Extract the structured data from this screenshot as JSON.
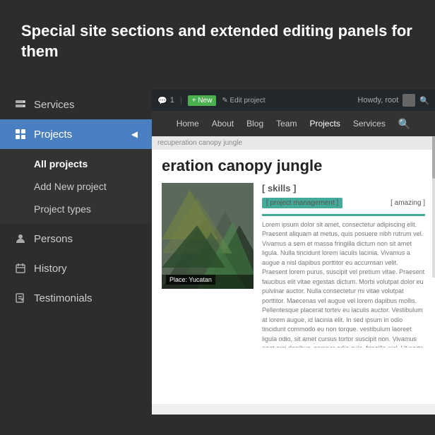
{
  "header": {
    "title": "Special site sections and extended editing panels for them"
  },
  "sidebar": {
    "items": [
      {
        "id": "services",
        "label": "Services",
        "icon": "server-icon",
        "active": false
      },
      {
        "id": "projects",
        "label": "Projects",
        "icon": "grid-icon",
        "active": true,
        "arrow": "◀"
      },
      {
        "id": "persons",
        "label": "Persons",
        "icon": "person-icon",
        "active": false
      },
      {
        "id": "history",
        "label": "History",
        "icon": "calendar-icon",
        "active": false
      },
      {
        "id": "testimonials",
        "label": "Testimonials",
        "icon": "edit-icon",
        "active": false
      }
    ],
    "submenu": {
      "items": [
        {
          "label": "All projects",
          "active": true
        },
        {
          "label": "Add New project",
          "active": false
        },
        {
          "label": "Project types",
          "active": false
        }
      ]
    }
  },
  "adminbar": {
    "comments": "1",
    "new_label": "+ New",
    "edit_label": "✎ Edit project",
    "howdy": "Howdy, root",
    "separator": "|"
  },
  "sitenav": {
    "links": [
      "Home",
      "About",
      "Blog",
      "Team",
      "Projects",
      "Services"
    ],
    "active": "Projects"
  },
  "breadcrumb": {
    "text": "recuperation canopy jungle"
  },
  "content": {
    "project_title": "eration canopy jungle",
    "image_label": "Place: Yucatan",
    "skills_section": "[ skills ]",
    "skill_tag": "[ project management ]",
    "skill_rating_label": "[ amazing ]",
    "lorem_text": "Lorem ipsum dolor sit amet, consectetur adipiscing elit. Praesent aliquam at metus, quis posuere nibh rutrum vel. Vivamus a sem et massa fringilla dictum non sit amet ligula. Nulla tincidunt lorem iaculis lacinia. Vivamus a augue a nisl dapibus porttitor eu accumsan velit. Praesent lorem purus, suscipit vel pretium vitae. Praesent faucibus elit vitae egestas dictum. Morbi volutpat dolor eu pulvinar auctor. Nulla consectetur mi vitae volutpat porttitor. Maecenas vel augue vel lorem dapibus mollis. Pellentesque placerat tortev eu iaculis auctor. Vestibulum at lorem augue, id lacinia elit. In sed ipsum in odio tincidunt commodo eu non torque. vestibulum laoreet ligula odio, sit amet cursus tortor suscipit non. Vivamus eget orci dapibus, semper odio quis, fringilla nisl.\n\nUt porta facilisis mattis. Nullam id ante orci. Quisque in venenatis est. Mauris interdum efficitur iusto a lorem. Quisque vitae ipsum eget pretium consequat porttitor eu accumsan velit. Praesent lorem purus, suscipit vel pretium vitae. Praesent commodo sed lectus, integer risus diam lectus non erat id volutpat."
  },
  "colors": {
    "sidebar_bg": "#2d2d2d",
    "active_blue": "#4a7fc1",
    "skill_green": "#4CAF50",
    "text_light": "#cccccc"
  }
}
